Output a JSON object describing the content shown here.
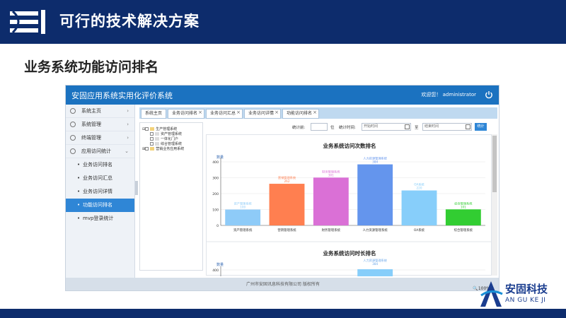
{
  "slide": {
    "title": "可行的技术解决方案",
    "subtitle": "业务系统功能访问排名"
  },
  "app": {
    "title": "安固应用系统实用化评价系统",
    "welcome": "欢迎您！ administrator",
    "footer": "广州市安固讯息科技有限公司 版权所有",
    "zoom": "🔍100%"
  },
  "sidebar": {
    "items": [
      {
        "label": "系统主页",
        "chev": "›"
      },
      {
        "label": "系统管理",
        "chev": "›"
      },
      {
        "label": "终端管理",
        "chev": "›"
      },
      {
        "label": "应用访问统计",
        "chev": "⌄"
      }
    ],
    "subitems": [
      {
        "label": "业务访问排名"
      },
      {
        "label": "业务访问汇总"
      },
      {
        "label": "业务访问详情"
      },
      {
        "label": "功能访问排名"
      },
      {
        "label": "mvp登录统计"
      }
    ]
  },
  "tabs": [
    {
      "label": "系统主页"
    },
    {
      "label": "业务访问排名"
    },
    {
      "label": "业务访问汇总"
    },
    {
      "label": "业务访问详情"
    },
    {
      "label": "功能访问排名"
    }
  ],
  "tree": [
    {
      "label": "生产管理系统"
    },
    {
      "label": "资产管理系统"
    },
    {
      "label": "一体化门户"
    },
    {
      "label": "综合管理系统"
    },
    {
      "label": "营销业务应用系统"
    }
  ],
  "filters": {
    "count_label": "统计前:",
    "unit": "位",
    "time_label": "统计时间:",
    "start_placeholder": "开始时间",
    "to": "至",
    "end_placeholder": "结束时间",
    "button": "统计"
  },
  "brand": {
    "cn": "安固科技",
    "en": "AN GU KE JI"
  },
  "chart_data": [
    {
      "type": "bar",
      "title": "业务系统访问次数排名",
      "ylabel": "数量",
      "ylim": [
        0,
        400
      ],
      "yticks": [
        "0",
        "100",
        "200",
        "300",
        "400"
      ],
      "categories": [
        "资产管理系统",
        "营销管理系统",
        "财务管理系统",
        "人力资源管理系统",
        "OA系统",
        "综合管理系统"
      ],
      "values": [
        100,
        262,
        301,
        384,
        220,
        101
      ],
      "value_labels": [
        "100",
        "262",
        "301",
        "384",
        "220",
        "101"
      ],
      "colors": [
        "#8ecbf8",
        "#ff7f50",
        "#da70d6",
        "#6495ed",
        "#87cefa",
        "#32cd32"
      ]
    },
    {
      "type": "bar",
      "title": "业务系统访问时长排名",
      "ylabel": "数量",
      "yticks": [
        "400"
      ],
      "categories": [
        "人力资源管理系统"
      ],
      "value_labels": [
        "384"
      ]
    }
  ]
}
